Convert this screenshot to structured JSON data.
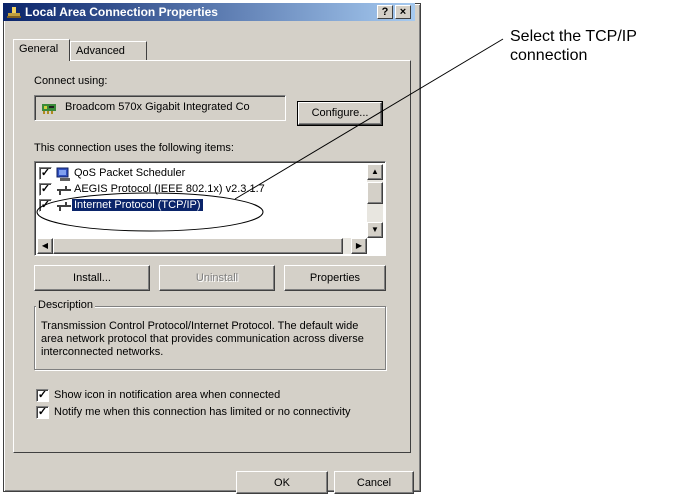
{
  "window": {
    "title": "Local Area Connection Properties",
    "help_button": "?",
    "close_button": "×"
  },
  "tabs": [
    {
      "label": "General",
      "active": true
    },
    {
      "label": "Advanced",
      "active": false
    }
  ],
  "connect_using": {
    "label": "Connect using:",
    "adapter": "Broadcom 570x Gigabit Integrated Co",
    "configure_button": "Configure..."
  },
  "items": {
    "label": "This connection uses the following items:",
    "list": [
      {
        "label": "QoS Packet Scheduler",
        "checked": true,
        "icon": "scheduler-icon",
        "selected": false
      },
      {
        "label": "AEGIS Protocol (IEEE 802.1x) v2.3.1.7",
        "checked": true,
        "icon": "protocol-icon",
        "selected": false
      },
      {
        "label": "Internet Protocol (TCP/IP)",
        "checked": true,
        "icon": "protocol-icon",
        "selected": true
      }
    ]
  },
  "buttons": {
    "install": "Install...",
    "uninstall": "Uninstall",
    "properties": "Properties",
    "ok": "OK",
    "cancel": "Cancel"
  },
  "description": {
    "legend": "Description",
    "text": "Transmission Control Protocol/Internet Protocol. The default wide area network protocol that provides communication across diverse interconnected networks."
  },
  "options": {
    "show_icon": {
      "label": "Show icon in notification area when connected",
      "checked": true
    },
    "notify": {
      "label": "Notify me when this connection has limited or no connectivity",
      "checked": true
    }
  },
  "annotation": {
    "text": "Select the TCP/IP\nconnection"
  },
  "colors": {
    "titlebar_start": "#0a246a",
    "titlebar_end": "#a6caf0",
    "dialog_face": "#d4d0c8",
    "selection": "#0a246a"
  }
}
